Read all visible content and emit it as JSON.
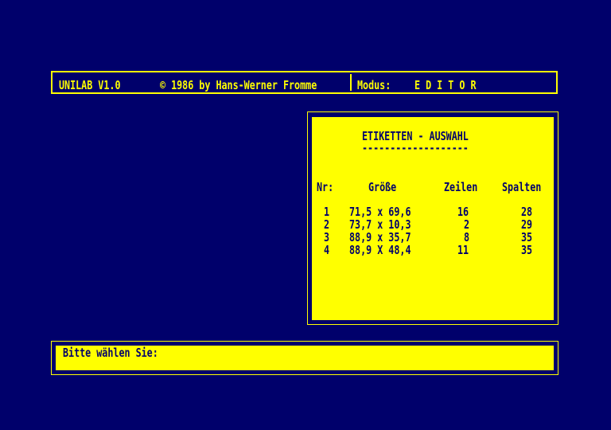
{
  "header": {
    "app": "UNILAB V1.0",
    "copyright": "© 1986 by Hans-Werner Fromme",
    "mode_label": "Modus:",
    "mode_value": "E D I T O R"
  },
  "panel": {
    "title": "ETIKETTEN - AUSWAHL",
    "underline": "-------------------",
    "columns": [
      "Nr:",
      "Größe",
      "Zeilen",
      "Spalten"
    ],
    "rows": [
      {
        "nr": "1",
        "size": "71,5 x 69,6",
        "lines": "16",
        "cols": "28"
      },
      {
        "nr": "2",
        "size": "73,7 x 10,3",
        "lines": "2",
        "cols": "29"
      },
      {
        "nr": "3",
        "size": "88,9 x 35,7",
        "lines": "8",
        "cols": "35"
      },
      {
        "nr": "4",
        "size": "88,9 X 48,4",
        "lines": "11",
        "cols": "35"
      }
    ]
  },
  "prompt": {
    "label": "Bitte wählen Sie:"
  }
}
